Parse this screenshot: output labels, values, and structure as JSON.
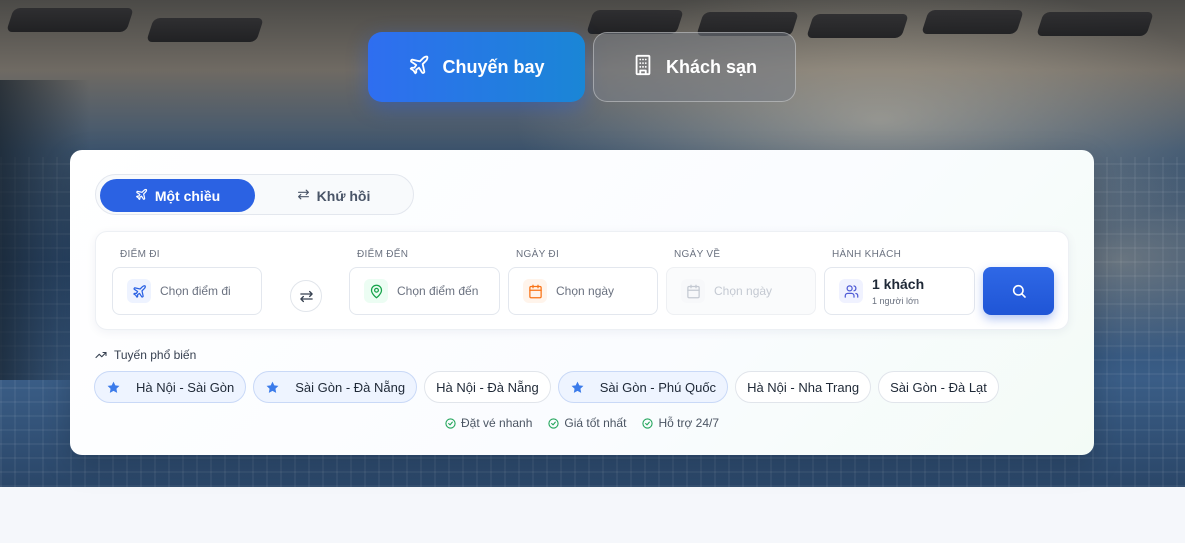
{
  "top_tabs": {
    "flight": {
      "label": "Chuyến bay",
      "icon": "plane-icon"
    },
    "hotel": {
      "label": "Khách sạn",
      "icon": "building-icon"
    }
  },
  "trip_type": {
    "one_way": {
      "label": "Một chiều",
      "icon": "plane-icon",
      "selected": true
    },
    "round_trip": {
      "label": "Khứ hồi",
      "icon": "swap-arrows-icon",
      "selected": false
    }
  },
  "fields": {
    "origin": {
      "label": "ĐIỂM ĐI",
      "placeholder": "Chọn điểm đi",
      "icon": "plane-icon"
    },
    "destination": {
      "label": "ĐIỂM ĐẾN",
      "placeholder": "Chọn điểm đến",
      "icon": "map-pin-icon"
    },
    "depart_date": {
      "label": "NGÀY ĐI",
      "placeholder": "Chọn ngày",
      "icon": "calendar-icon"
    },
    "return_date": {
      "label": "NGÀY VỀ",
      "placeholder": "Chọn ngày",
      "icon": "calendar-icon",
      "disabled": true
    },
    "passengers": {
      "label": "HÀNH KHÁCH",
      "value": "1 khách",
      "detail": "1 người lớn",
      "icon": "users-icon"
    }
  },
  "search_button_icon": "search-icon",
  "popular": {
    "title": "Tuyến phổ biến",
    "routes": [
      {
        "label": "Hà Nội - Sài Gòn",
        "starred": true
      },
      {
        "label": "Sài Gòn - Đà Nẵng",
        "starred": true
      },
      {
        "label": "Hà Nội - Đà Nẵng",
        "starred": false
      },
      {
        "label": "Sài Gòn - Phú Quốc",
        "starred": true
      },
      {
        "label": "Hà Nội - Nha Trang",
        "starred": false
      },
      {
        "label": "Sài Gòn - Đà Lạt",
        "starred": false
      }
    ]
  },
  "features": [
    {
      "label": "Đặt vé nhanh"
    },
    {
      "label": "Giá tốt nhất"
    },
    {
      "label": "Hỗ trợ 24/7"
    }
  ],
  "colors": {
    "primary": "#2b62e3",
    "star": "#3b7bea",
    "check": "#22a55b",
    "calendar_accent": "#f97316",
    "pin_accent": "#16a34a"
  }
}
